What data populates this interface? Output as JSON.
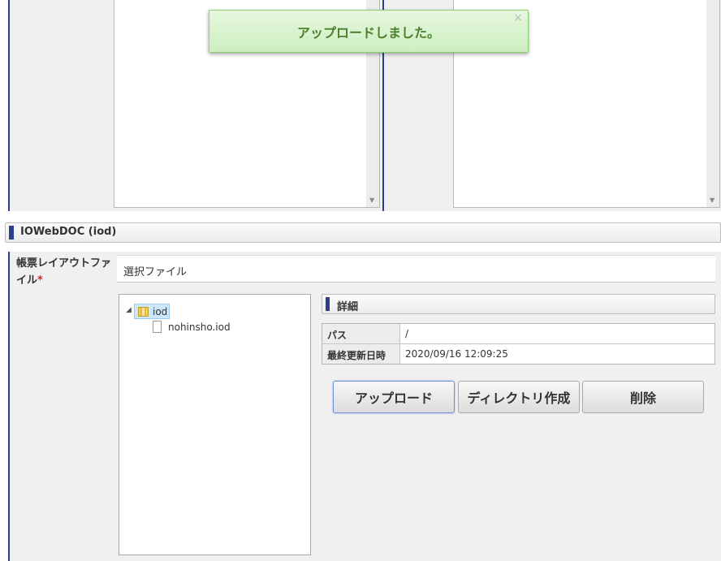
{
  "toast": {
    "message": "アップロードしました。",
    "close_label": "×"
  },
  "section": {
    "title": "IOWebDOC (iod)"
  },
  "form": {
    "field_label": "帳票レイアウトファイル",
    "required_mark": "*",
    "selected_file_label": "選択ファイル"
  },
  "tree": {
    "root": {
      "label": "iod",
      "icon": "folder-icon",
      "expanded": true
    },
    "children": [
      {
        "label": "nohinsho.iod",
        "icon": "file-icon"
      }
    ]
  },
  "detail": {
    "title": "詳細",
    "rows": [
      {
        "label": "パス",
        "value": "/"
      },
      {
        "label": "最終更新日時",
        "value": "2020/09/16 12:09:25"
      }
    ]
  },
  "buttons": {
    "upload": "アップロード",
    "mkdir": "ディレクトリ作成",
    "delete": "削除"
  },
  "colors": {
    "accent": "#2c3f8c",
    "toast_text": "#4a7f2c",
    "required": "#d4221e"
  }
}
